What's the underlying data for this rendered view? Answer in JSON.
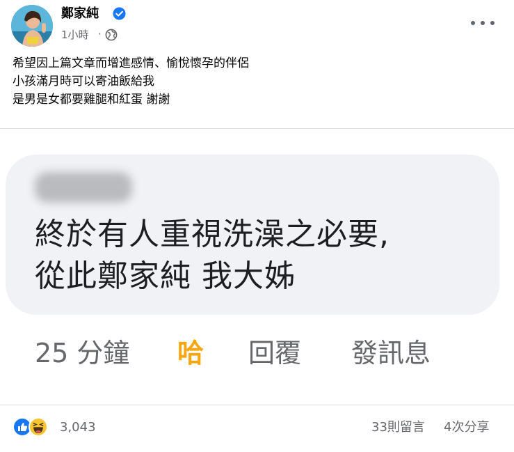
{
  "post": {
    "author": "鄭家純",
    "time": "1小時",
    "dot": "·",
    "verified_icon": "verified-badge-icon",
    "privacy_icon": "globe-icon",
    "text_lines": [
      "希望因上篇文章而增進感情、愉悅懷孕的伴侶",
      "小孩滿月時可以寄油飯給我",
      "是男是女都要雞腿和紅蛋 謝謝"
    ]
  },
  "screenshot_comment": {
    "lines": [
      "終於有人重視洗澡之必要,",
      "從此鄭家純 我大姊"
    ],
    "time": "25 分鐘",
    "reaction": "哈",
    "reply": "回覆",
    "message": "發訊息"
  },
  "footer": {
    "reaction_count": "3,043",
    "comments": "33則留言",
    "shares": "4次分享"
  },
  "colors": {
    "accent_blue": "#1877f2",
    "haha_orange": "#f7a60d",
    "secondary_text": "#65676b",
    "bubble_bg": "#f0f2f5"
  }
}
